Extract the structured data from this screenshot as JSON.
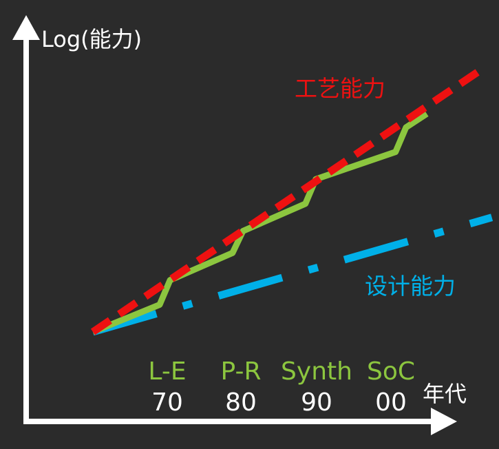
{
  "chart_data": {
    "type": "line",
    "ylabel": "Log(能力)",
    "xlabel": "年代",
    "decades": [
      "70",
      "80",
      "90",
      "00"
    ],
    "eras": [
      "L-E",
      "P-R",
      "Synth",
      "SoC"
    ],
    "xlim": [
      1965,
      2010
    ],
    "ylim": [
      0,
      1
    ],
    "series": [
      {
        "name": "工艺能力",
        "color": "#ee1111",
        "style": "dashed",
        "x": [
          1965,
          2009.7
        ],
        "y": [
          0.0,
          0.96
        ]
      },
      {
        "name": "",
        "color": "#8cc63f",
        "style": "solid",
        "x": [
          1965,
          1972.7,
          1973.9,
          1981.1,
          1982.3,
          1989.5,
          1990.7,
          1999.9,
          2001.1,
          2003.5
        ],
        "y": [
          0.0,
          0.1,
          0.19,
          0.29,
          0.37,
          0.47,
          0.56,
          0.66,
          0.75,
          0.8
        ]
      },
      {
        "name": "设计能力",
        "color": "#00b0e8",
        "style": "dashdot",
        "x": [
          1965,
          2011
        ],
        "y": [
          0.0,
          0.42
        ]
      }
    ],
    "series_labels": {
      "process": "工艺能力",
      "design": "设计能力"
    },
    "colors": {
      "axis": "#ffffff",
      "era_label": "#8cc63f",
      "decade_label": "#ffffff",
      "background": "#2b2b2b"
    }
  }
}
